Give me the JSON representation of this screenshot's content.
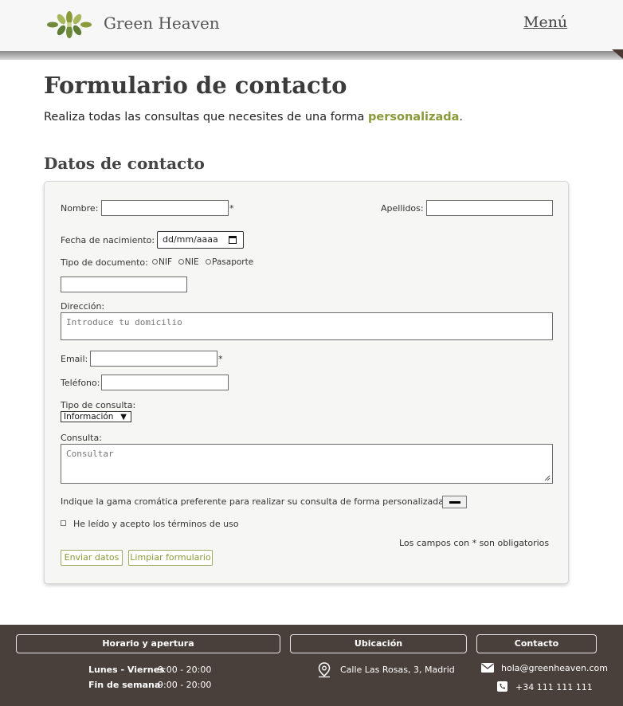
{
  "header": {
    "brand": "Green Heaven",
    "menu_label": "Menú",
    "logo_icon": "leaf-logo-icon"
  },
  "main": {
    "title": "Formulario de contacto",
    "intro_text": "Realiza todas las consultas que necesites de una forma ",
    "intro_highlight": "personalizada",
    "intro_end": ".",
    "section_title": "Datos de contacto"
  },
  "form": {
    "nombre_label": "Nombre:",
    "apellidos_label": "Apellidos:",
    "required_mark": "*",
    "fecha_label": "Fecha  de  nacimiento:",
    "fecha_value": "dd/mm/aaaa",
    "tipo_doc_label": "Tipo  de  documento:",
    "doc_options": [
      "NIF",
      "NIE",
      "Pasaporte"
    ],
    "direccion_label": "Dirección:",
    "direccion_placeholder": "Introduce tu domicilio",
    "email_label": "Email:",
    "telefono_label": "Teléfono:",
    "tipo_consulta_label": "Tipo  de  consulta:",
    "tipo_consulta_value": "Información",
    "consulta_label": "Consulta:",
    "consulta_placeholder": "Consultar",
    "color_label": "Indique  la  gama  cromática  preferente  para  realizar  su  consulta  de  forma  personalizada:",
    "color_value": "#000000",
    "terms_label": "He  leído  y  acepto  los  términos  de  uso",
    "required_note": "Los  campos  con  *  son  obligatorios",
    "submit_label": "Enviar datos",
    "reset_label": "Limpiar formulario"
  },
  "footer": {
    "hours_title": "Horario y apertura",
    "weekday_label": "Lunes - Viernes",
    "weekday_hours": "9:00 - 20:00",
    "weekend_label": "Fin de semana",
    "weekend_hours": "9:00 - 20:00",
    "location_title": "Ubicación",
    "address": "Calle Las Rosas, 3, Madrid",
    "contact_title": "Contacto",
    "email": "hola@greenheaven.com",
    "phone": "+34 111 111 111"
  },
  "colors": {
    "accent": "#8a9a3b",
    "footer_bg": "#4a403b",
    "header_bg": "#f7f7f7"
  }
}
